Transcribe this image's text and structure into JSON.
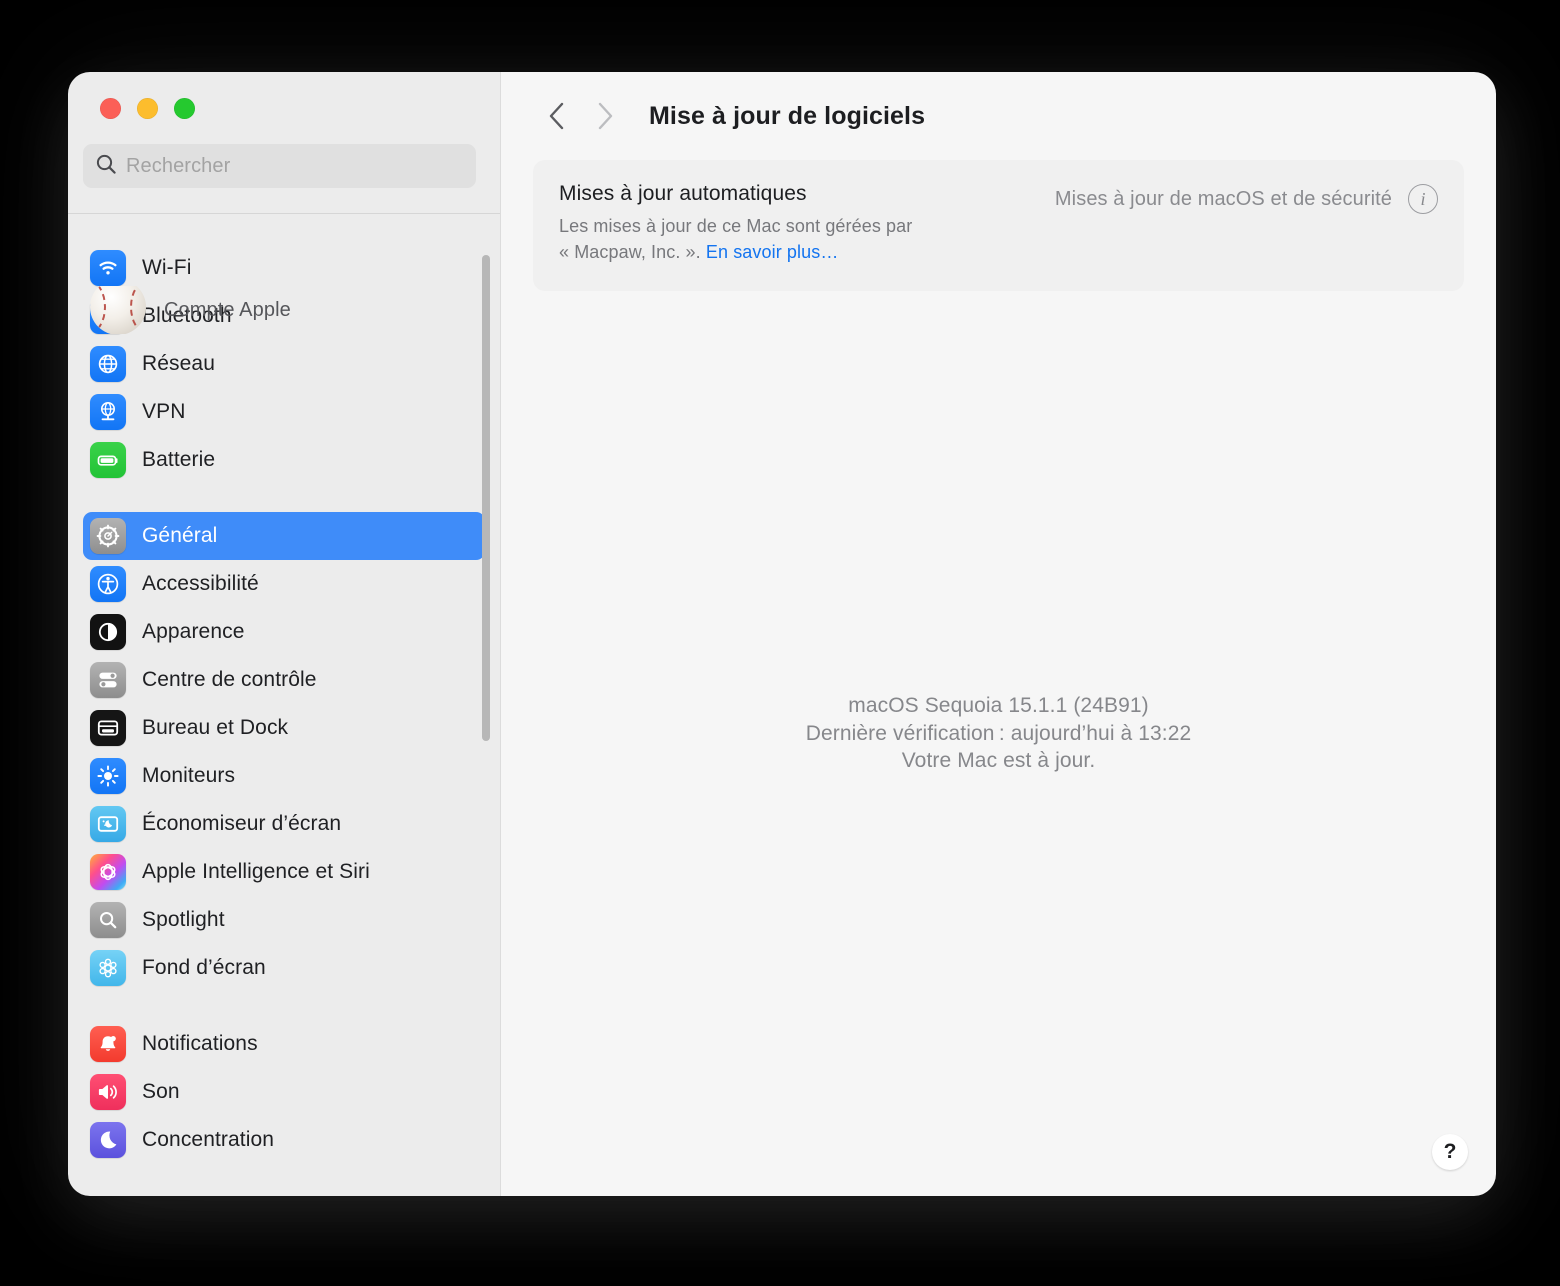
{
  "window": {
    "traffic_lights": [
      {
        "name": "close",
        "color": "#fb5f57"
      },
      {
        "name": "minimize",
        "color": "#fcbd2d"
      },
      {
        "name": "zoom",
        "color": "#25c92f"
      }
    ]
  },
  "sidebar": {
    "search": {
      "placeholder": "Rechercher",
      "value": "",
      "icon": "search-icon"
    },
    "account": {
      "label": "Compte Apple",
      "avatar": "baseball-avatar"
    },
    "groups": [
      {
        "items": [
          {
            "label": "Wi-Fi",
            "icon": "wifi-icon",
            "selected": false
          },
          {
            "label": "Bluetooth",
            "icon": "bluetooth-icon",
            "selected": false
          },
          {
            "label": "Réseau",
            "icon": "network-globe-icon",
            "selected": false
          },
          {
            "label": "VPN",
            "icon": "vpn-icon",
            "selected": false
          },
          {
            "label": "Batterie",
            "icon": "battery-icon",
            "selected": false
          }
        ]
      },
      {
        "items": [
          {
            "label": "Général",
            "icon": "gear-icon",
            "selected": true
          },
          {
            "label": "Accessibilité",
            "icon": "accessibility-icon",
            "selected": false
          },
          {
            "label": "Apparence",
            "icon": "appearance-icon",
            "selected": false
          },
          {
            "label": "Centre de contrôle",
            "icon": "control-center-icon",
            "selected": false
          },
          {
            "label": "Bureau et Dock",
            "icon": "desktop-dock-icon",
            "selected": false
          },
          {
            "label": "Moniteurs",
            "icon": "displays-icon",
            "selected": false
          },
          {
            "label": "Économiseur d’écran",
            "icon": "screensaver-icon",
            "selected": false
          },
          {
            "label": "Apple Intelligence et Siri",
            "icon": "apple-intelligence-icon",
            "selected": false
          },
          {
            "label": "Spotlight",
            "icon": "spotlight-icon",
            "selected": false
          },
          {
            "label": "Fond d’écran",
            "icon": "wallpaper-icon",
            "selected": false
          }
        ]
      },
      {
        "items": [
          {
            "label": "Notifications",
            "icon": "notifications-bell-icon",
            "selected": false
          },
          {
            "label": "Son",
            "icon": "sound-speaker-icon",
            "selected": false
          },
          {
            "label": "Concentration",
            "icon": "focus-moon-icon",
            "selected": false
          }
        ]
      }
    ]
  },
  "toolbar": {
    "back_icon": "chevron-left-icon",
    "forward_icon": "chevron-right-icon",
    "title": "Mise à jour de logiciels"
  },
  "card": {
    "title": "Mises à jour automatiques",
    "desc_line1": "Les mises à jour de ce Mac sont gérées par",
    "desc_line2_prefix": "« Macpaw, Inc. ». ",
    "link": "En savoir plus…",
    "right_label": "Mises à jour de macOS et de sécurité",
    "info_icon": "info-icon",
    "info_glyph": "i"
  },
  "status": {
    "line1": "macOS Sequoia 15.1.1 (24B91)",
    "line2": "Dernière vérification : aujourd’hui à 13:22",
    "line3": "Votre Mac est à jour."
  },
  "help": {
    "glyph": "?",
    "icon": "help-question-icon"
  },
  "colors": {
    "accent": "#3f8cf9",
    "link": "#1374f0",
    "sidebar_bg": "#ececec",
    "content_bg": "#f6f6f6",
    "card_bg": "#f0f0f0"
  }
}
